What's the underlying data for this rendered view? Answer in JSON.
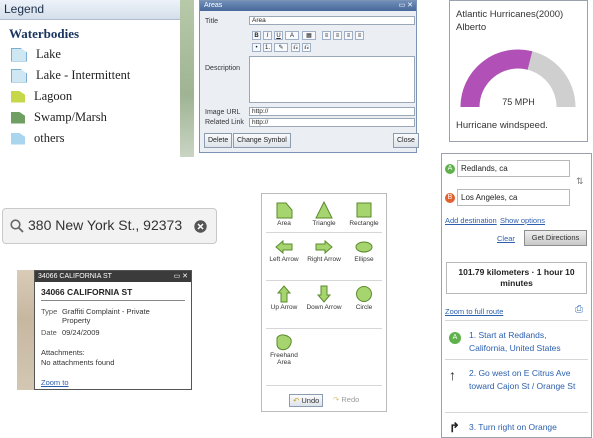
{
  "legend": {
    "header": "Legend",
    "category": "Waterbodies",
    "items": [
      {
        "label": "Lake",
        "color": "#cfe6f3"
      },
      {
        "label": "Lake - Intermittent",
        "color": "#cfe6f3"
      },
      {
        "label": "Lagoon",
        "color": "#c6d84a"
      },
      {
        "label": "Swamp/Marsh",
        "color": "#6f9f63"
      },
      {
        "label": "others",
        "color": "#a9d5ef"
      }
    ]
  },
  "areas_dialog": {
    "title": "Areas",
    "title_label": "Title",
    "title_value": "Area",
    "description_label": "Description",
    "image_url_label": "Image URL",
    "image_url_value": "http://",
    "related_link_label": "Related Link",
    "related_link_value": "http://",
    "toolbar": [
      "B",
      "I",
      "U",
      "A",
      "▦",
      "≡",
      "≡",
      "≡",
      "≡",
      "•",
      "1.",
      "✎",
      "⎌",
      "⎌"
    ],
    "buttons": {
      "delete": "Delete",
      "change_symbol": "Change Symbol",
      "close": "Close"
    }
  },
  "gauge": {
    "title": "Atlantic Hurricanes(2000)",
    "subtitle": "Alberto",
    "value_text": "75 MPH",
    "fraction": 0.58,
    "caption": "Hurricane windspeed.",
    "fill_color": "#b150b6",
    "track_color": "#cfcfcf"
  },
  "search": {
    "value": "380 New York St., 92373"
  },
  "popup": {
    "title": "34066 CALIFORNIA ST",
    "heading": "34066 CALIFORNIA ST",
    "type_label": "Type",
    "type_value": "Graffiti Complaint - Private Property",
    "date_label": "Date",
    "date_value": "09/24/2009",
    "attachments_label": "Attachments:",
    "attachments_value": "No attachments found",
    "zoom_link": "Zoom to"
  },
  "draw": {
    "tools": [
      {
        "label": "Area",
        "icon": "area-icon"
      },
      {
        "label": "Triangle",
        "icon": "triangle-icon"
      },
      {
        "label": "Rectangle",
        "icon": "rectangle-icon"
      },
      {
        "label": "Left Arrow",
        "icon": "left-arrow-icon"
      },
      {
        "label": "Right Arrow",
        "icon": "right-arrow-icon"
      },
      {
        "label": "Ellipse",
        "icon": "ellipse-icon"
      },
      {
        "label": "Up Arrow",
        "icon": "up-arrow-icon"
      },
      {
        "label": "Down Arrow",
        "icon": "down-arrow-icon"
      },
      {
        "label": "Circle",
        "icon": "circle-icon"
      },
      {
        "label": "Freehand Area",
        "icon": "freehand-area-icon"
      }
    ],
    "undo_label": "Undo",
    "redo_label": "Redo",
    "shape_fill": "#a6d46e",
    "shape_stroke": "#5b8a2d"
  },
  "directions": {
    "from": "Redlands, ca",
    "to": "Los Angeles, ca",
    "from_marker": "A",
    "to_marker": "B",
    "add_destination": "Add destination",
    "show_options": "Show options",
    "clear": "Clear",
    "get_directions": "Get Directions",
    "summary_line1": "101.79 kilometers · 1 hour 10",
    "summary_line2": "minutes",
    "zoom_full_route": "Zoom to full route",
    "steps": [
      {
        "marker": "A",
        "text": "1. Start at Redlands, California, United States"
      },
      {
        "marker": "↑",
        "text": "2. Go west on E Citrus Ave toward Cajon St / Orange St"
      },
      {
        "marker": "↱",
        "text": "3. Turn right on Orange"
      }
    ]
  }
}
